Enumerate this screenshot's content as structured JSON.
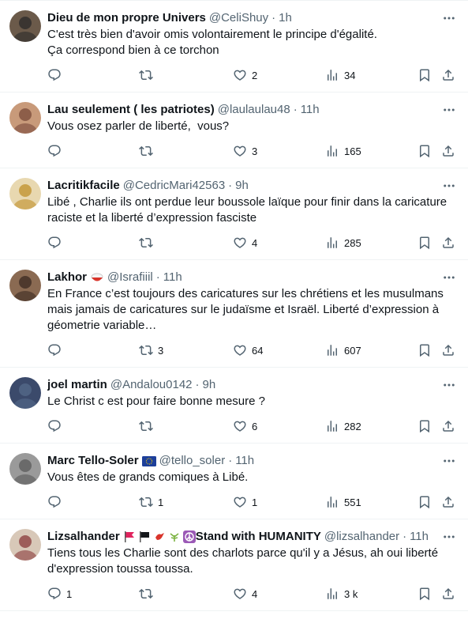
{
  "tweets": [
    {
      "name": "Dieu de mon propre Univers",
      "handle": "@CeliShuy",
      "time": "1h",
      "text": "C'est très bien d'avoir omis volontairement le principe d'égalité.\nÇa correspond bien à ce torchon",
      "replies": "",
      "retweets": "",
      "likes": "2",
      "views": "34",
      "avatar_color": "#6b5a4a"
    },
    {
      "name": "Lau seulement ( les patriotes)",
      "handle": "@laulaulau48",
      "time": "11h",
      "text": "Vous osez parler de liberté,  vous?",
      "replies": "",
      "retweets": "",
      "likes": "3",
      "views": "165",
      "avatar_color": "#c89a7a"
    },
    {
      "name": "Lacritikfacile",
      "handle": "@CedricMari42563",
      "time": "9h",
      "text": "Libé , Charlie ils ont perdue leur boussole laïque pour finir dans la caricature raciste et la liberté d’expression fasciste",
      "replies": "",
      "retweets": "",
      "likes": "4",
      "views": "285",
      "avatar_color": "#e8d8b0"
    },
    {
      "name": "Lakhor",
      "handle": "@Israfiiil",
      "time": "11h",
      "text": "En France c’est toujours des caricatures sur les chrétiens et les musulmans mais jamais de caricatures sur le judaïsme et Israël. Liberté d’expression à géometrie variable…",
      "replies": "",
      "retweets": "3",
      "likes": "64",
      "views": "607",
      "avatar_color": "#8a6a52"
    },
    {
      "name": "joel martin",
      "handle": "@Andalou0142",
      "time": "9h",
      "text": "Le Christ c est pour faire bonne mesure ?",
      "replies": "",
      "retweets": "",
      "likes": "6",
      "views": "282",
      "avatar_color": "#3b4a6b"
    },
    {
      "name": "Marc Tello-Soler",
      "handle": "@tello_soler",
      "time": "11h",
      "text": "Vous êtes de grands comiques à Libé.",
      "replies": "",
      "retweets": "1",
      "likes": "1",
      "views": "551",
      "avatar_color": "#9a9a9a"
    },
    {
      "name": "Lizsalhander",
      "name_suffix": "Stand with HUMANITY",
      "handle": "@lizsalhander",
      "time": "11h",
      "text": "Tiens tous les Charlie sont des charlots parce qu'il y a Jésus, ah oui liberté d'expression toussa toussa.",
      "replies": "1",
      "retweets": "",
      "likes": "4",
      "views": "3 k",
      "avatar_color": "#d8c8b8"
    }
  ],
  "separator": "·",
  "colors": {
    "text": "#0f1419",
    "secondary": "#536471",
    "border": "#eff3f4"
  },
  "icons": [
    "reply-icon",
    "retweet-icon",
    "like-icon",
    "views-icon",
    "bookmark-icon",
    "share-icon",
    "more-icon"
  ]
}
